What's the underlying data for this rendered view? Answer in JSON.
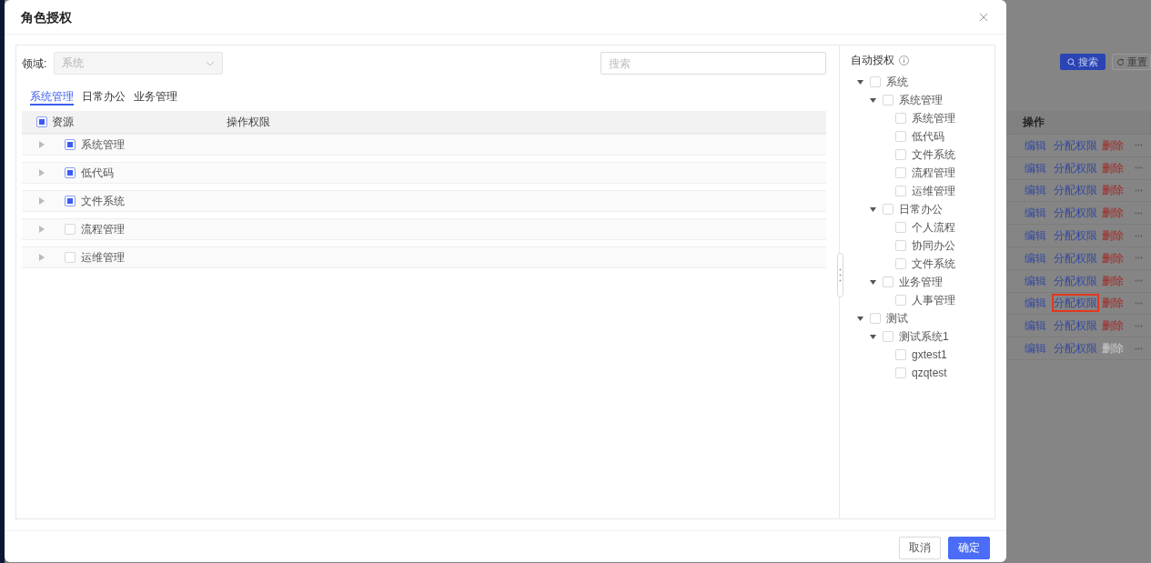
{
  "dialog": {
    "title": "角色授权"
  },
  "domain": {
    "label": "领域:",
    "value": "系统",
    "disabled": true
  },
  "search": {
    "placeholder": "搜索"
  },
  "tabs": [
    {
      "label": "系统管理",
      "selected": true
    },
    {
      "label": "日常办公",
      "selected": false
    },
    {
      "label": "业务管理",
      "selected": false
    }
  ],
  "resources_table": {
    "header": {
      "indeterminate": true,
      "columns": [
        "资源",
        "操作权限"
      ]
    },
    "rows": [
      {
        "name": "系统管理",
        "indeterminate": true,
        "expanded": false
      },
      {
        "name": "低代码",
        "indeterminate": true,
        "expanded": false
      },
      {
        "name": "文件系统",
        "indeterminate": true,
        "expanded": false
      },
      {
        "name": "流程管理",
        "indeterminate": false,
        "expanded": false
      },
      {
        "name": "运维管理",
        "indeterminate": false,
        "expanded": false
      }
    ]
  },
  "auto_auth": {
    "title": "自动授权",
    "tree": [
      {
        "label": "系统",
        "checked": false,
        "expanded": true,
        "children": [
          {
            "label": "系统管理",
            "checked": false,
            "expanded": true,
            "children": [
              {
                "label": "系统管理",
                "checked": false
              },
              {
                "label": "低代码",
                "checked": false
              },
              {
                "label": "文件系统",
                "checked": false
              },
              {
                "label": "流程管理",
                "checked": false
              },
              {
                "label": "运维管理",
                "checked": false
              }
            ]
          },
          {
            "label": "日常办公",
            "checked": false,
            "expanded": true,
            "children": [
              {
                "label": "个人流程",
                "checked": false
              },
              {
                "label": "协同办公",
                "checked": false
              },
              {
                "label": "文件系统",
                "checked": false
              }
            ]
          },
          {
            "label": "业务管理",
            "checked": false,
            "expanded": true,
            "children": [
              {
                "label": "人事管理",
                "checked": false
              }
            ]
          }
        ]
      },
      {
        "label": "测试",
        "checked": false,
        "expanded": true,
        "children": [
          {
            "label": "测试系统1",
            "checked": false,
            "expanded": true,
            "children": [
              {
                "label": "gxtest1",
                "checked": false
              },
              {
                "label": "qzqtest",
                "checked": false
              }
            ]
          }
        ]
      }
    ]
  },
  "footer": {
    "buttons": [
      {
        "label": "取消",
        "kind": "default"
      },
      {
        "label": "确定",
        "kind": "primary"
      }
    ]
  },
  "backdrop": {
    "buttons": [
      {
        "label": "搜索",
        "kind": "search"
      },
      {
        "label": "重置",
        "kind": "reset"
      }
    ],
    "table": {
      "columns": [
        "操作"
      ],
      "rows": [
        {
          "edit": "编辑",
          "assign": "分配权限",
          "delete": "删除",
          "assign_highlighted": false,
          "delete_disabled": false
        },
        {
          "edit": "编辑",
          "assign": "分配权限",
          "delete": "删除",
          "assign_highlighted": false,
          "delete_disabled": false
        },
        {
          "edit": "编辑",
          "assign": "分配权限",
          "delete": "删除",
          "assign_highlighted": false,
          "delete_disabled": false
        },
        {
          "edit": "编辑",
          "assign": "分配权限",
          "delete": "删除",
          "assign_highlighted": false,
          "delete_disabled": false
        },
        {
          "edit": "编辑",
          "assign": "分配权限",
          "delete": "删除",
          "assign_highlighted": false,
          "delete_disabled": false
        },
        {
          "edit": "编辑",
          "assign": "分配权限",
          "delete": "删除",
          "assign_highlighted": false,
          "delete_disabled": false
        },
        {
          "edit": "编辑",
          "assign": "分配权限",
          "delete": "删除",
          "assign_highlighted": false,
          "delete_disabled": false
        },
        {
          "edit": "编辑",
          "assign": "分配权限",
          "delete": "删除",
          "assign_highlighted": true,
          "delete_disabled": false
        },
        {
          "edit": "编辑",
          "assign": "分配权限",
          "delete": "删除",
          "assign_highlighted": false,
          "delete_disabled": false
        },
        {
          "edit": "编辑",
          "assign": "分配权限",
          "delete": "删除",
          "assign_highlighted": false,
          "delete_disabled": true
        }
      ]
    }
  }
}
